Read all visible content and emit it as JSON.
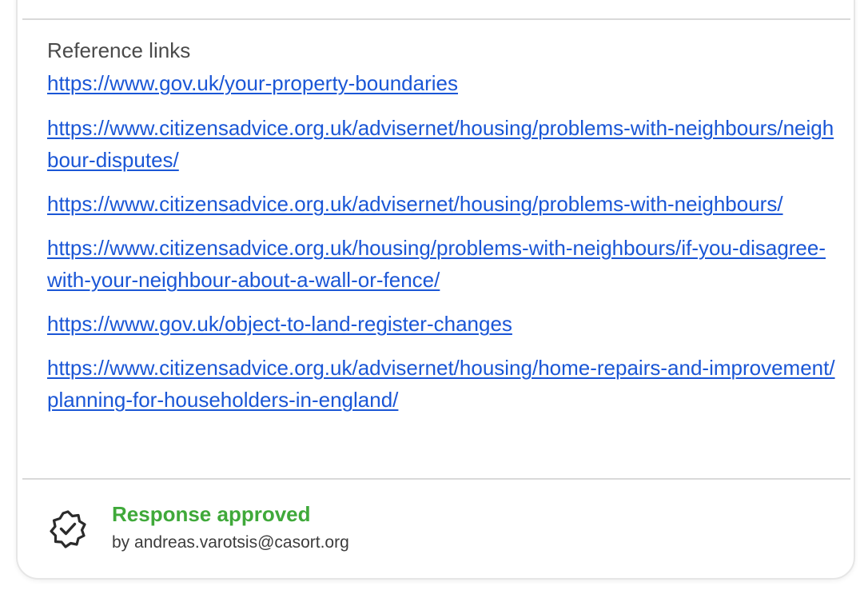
{
  "references": {
    "title": "Reference links",
    "links": [
      "https://www.gov.uk/your-property-boundaries",
      "https://www.citizensadvice.org.uk/advisernet/housing/problems-with-neighbours/neighbour-disputes/",
      "https://www.citizensadvice.org.uk/advisernet/housing/problems-with-neighbours/",
      "https://www.citizensadvice.org.uk/housing/problems-with-neighbours/if-you-disagree-with-your-neighbour-about-a-wall-or-fence/",
      "https://www.gov.uk/object-to-land-register-changes",
      "https://www.citizensadvice.org.uk/advisernet/housing/home-repairs-and-improvement/planning-for-householders-in-england/"
    ]
  },
  "approval": {
    "status": "Response approved",
    "by": "by andreas.varotsis@casort.org",
    "icon": "verified-badge-icon",
    "status_color": "#3fa93a"
  },
  "colors": {
    "link": "#1a56d6",
    "divider": "#d9d9d9"
  }
}
